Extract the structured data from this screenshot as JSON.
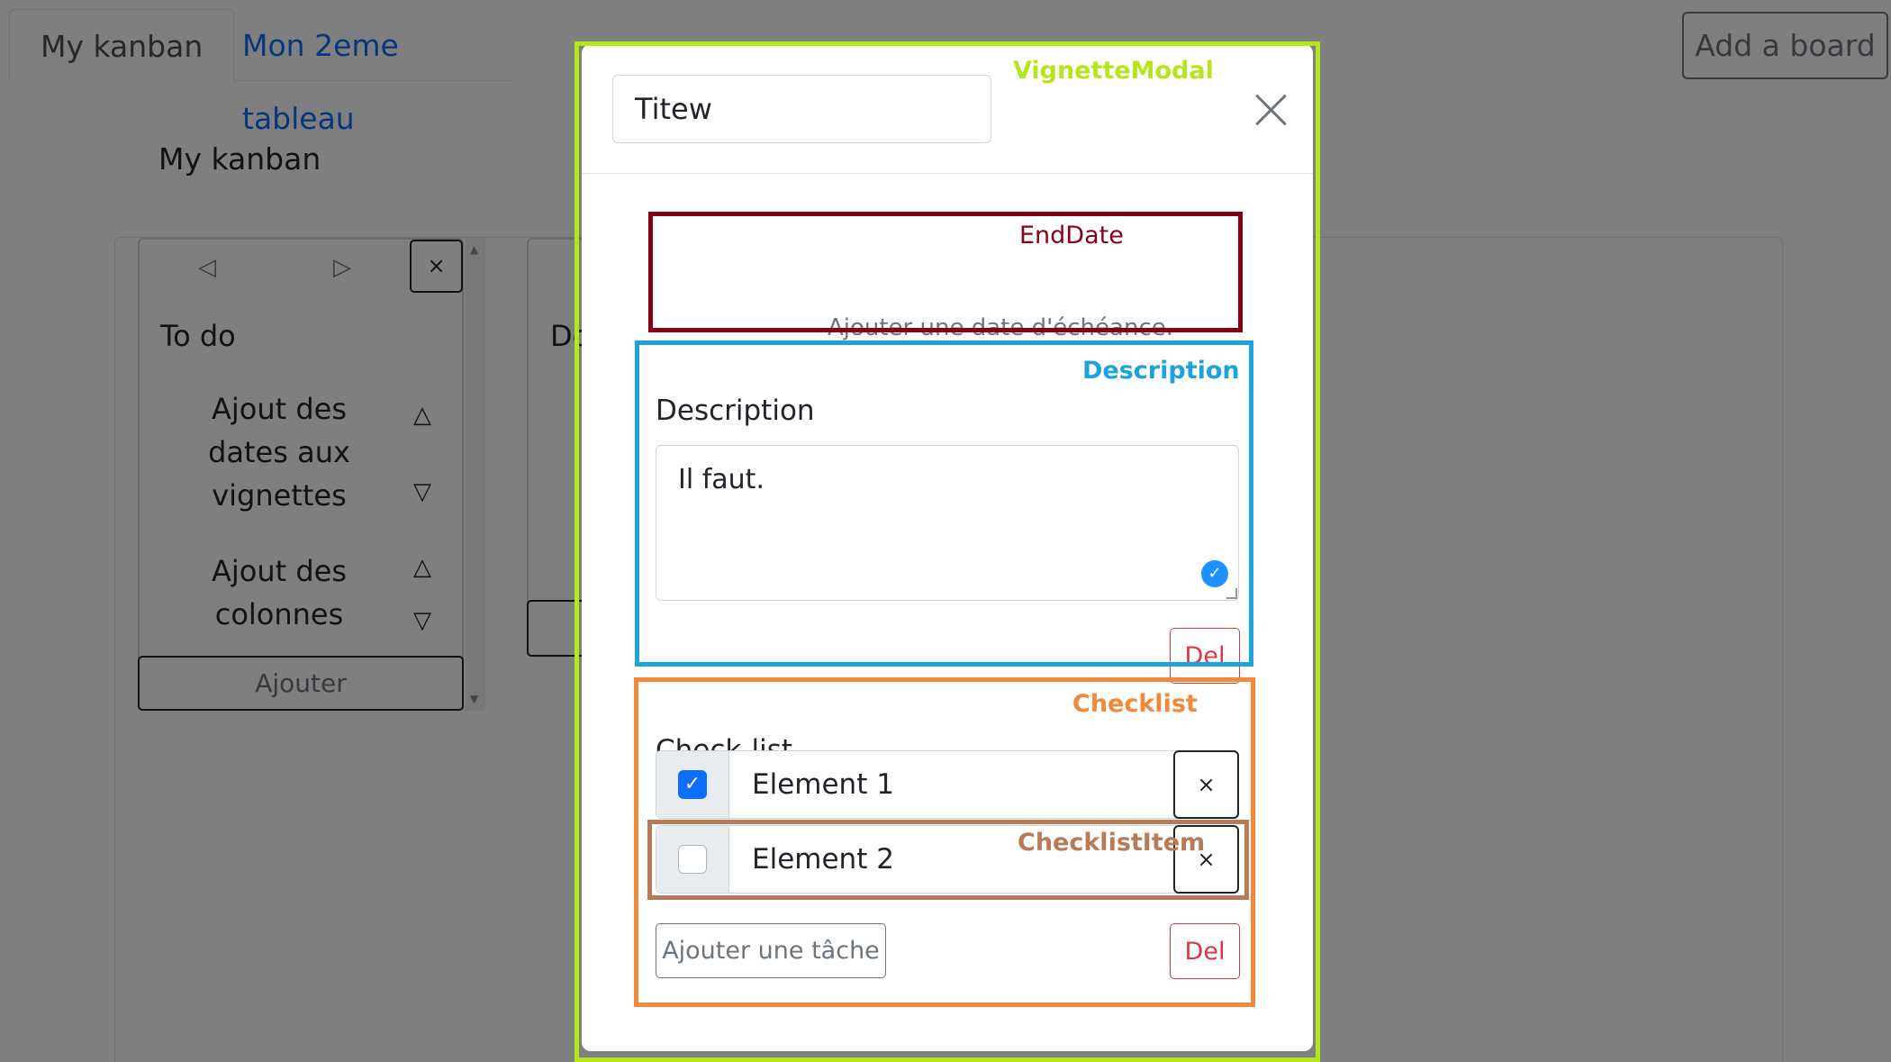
{
  "tabs": [
    {
      "label": "My kanban"
    },
    {
      "label": "Mon 2eme tableau"
    }
  ],
  "add_board_label": "Add a board",
  "board": {
    "title": "My kanban",
    "columns": [
      {
        "prev_icon": "◁",
        "next_icon": "▷",
        "close_label": "×",
        "title": "To do",
        "cards": [
          {
            "lines": [
              "Ajout des",
              "dates aux",
              "vignettes"
            ],
            "up_icon": "△",
            "down_icon": "▽"
          },
          {
            "lines": [
              "Ajout des",
              "colonnes"
            ],
            "up_icon": "△",
            "down_icon": "▽"
          }
        ],
        "add_label": "Ajouter"
      },
      {
        "title": "Do"
      }
    ]
  },
  "modal": {
    "title_value": "Titew",
    "close_icon": "close-icon",
    "end_date_placeholder": "Ajouter une date d'échéance.",
    "description": {
      "heading": "Description",
      "value": "Il faut.",
      "del_label": "Del"
    },
    "checklist": {
      "heading": "Check-list",
      "items": [
        {
          "label": "Element 1",
          "checked": true,
          "remove_label": "×"
        },
        {
          "label": "Element 2",
          "checked": false,
          "remove_label": "×"
        }
      ],
      "add_task_label": "Ajouter une tâche",
      "del_label": "Del"
    }
  },
  "annotations": [
    {
      "label": "VignetteModal",
      "color": "#b5e61d"
    },
    {
      "label": "EndDate",
      "color": "#880015"
    },
    {
      "label": "Description",
      "color": "#1ca3dc"
    },
    {
      "label": "Checklist",
      "color": "#f2883a"
    },
    {
      "label": "ChecklistItem",
      "color": "#b97a57"
    }
  ],
  "colors": {
    "primary": "#0d6efd",
    "danger": "#dc3545",
    "backdrop": "rgba(0,0,0,0.5)"
  }
}
